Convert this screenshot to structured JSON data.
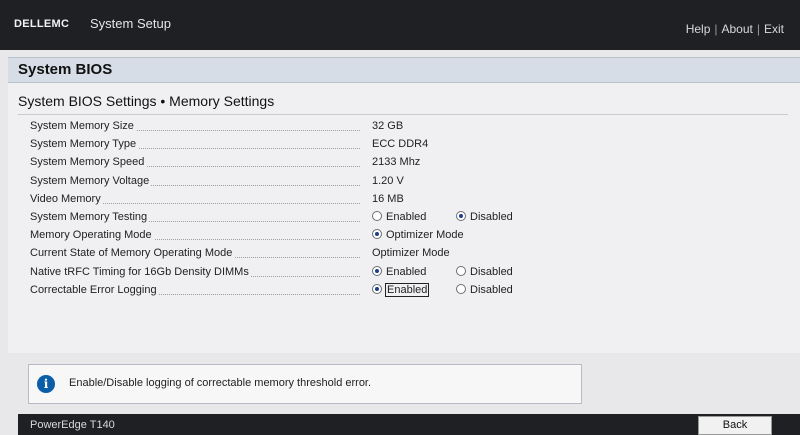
{
  "header": {
    "logo": "DELLEMC",
    "title": "System Setup",
    "links": [
      "Help",
      "About",
      "Exit"
    ]
  },
  "section": {
    "title": "System BIOS",
    "breadcrumb": "System BIOS Settings • Memory Settings"
  },
  "settings": [
    {
      "label": "System Memory Size",
      "value": "32 GB"
    },
    {
      "label": "System Memory Type",
      "value": "ECC DDR4"
    },
    {
      "label": "System Memory Speed",
      "value": "2133 Mhz"
    },
    {
      "label": "System Memory Voltage",
      "value": "1.20 V"
    },
    {
      "label": "Video Memory",
      "value": "16 MB"
    },
    {
      "label": "System Memory Testing",
      "options": [
        "Enabled",
        "Disabled"
      ],
      "selected": "Disabled"
    },
    {
      "label": "Memory Operating Mode",
      "options": [
        "Optimizer Mode"
      ],
      "selected": "Optimizer Mode"
    },
    {
      "label": "Current State of Memory Operating Mode",
      "value": "Optimizer Mode"
    },
    {
      "label": "Native tRFC Timing for 16Gb Density DIMMs",
      "options": [
        "Enabled",
        "Disabled"
      ],
      "selected": "Enabled"
    },
    {
      "label": "Correctable Error Logging",
      "options": [
        "Enabled",
        "Disabled"
      ],
      "selected": "Enabled"
    }
  ],
  "info": {
    "icon": "info-icon",
    "glyph": "i",
    "text": "Enable/Disable logging of correctable memory threshold error."
  },
  "footer": {
    "model": "PowerEdge T140",
    "back_label": "Back"
  },
  "colors": {
    "header_bg": "#1e2024",
    "section_bg": "#d6dde6",
    "radio_selected": "#1f3f8c",
    "info_icon": "#0a5ea8"
  }
}
